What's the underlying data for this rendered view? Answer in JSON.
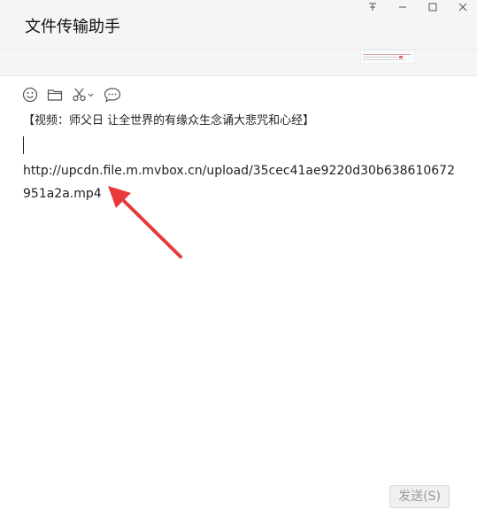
{
  "window": {
    "title": "文件传输助手",
    "controls": [
      "pin-icon",
      "minimize-icon",
      "maximize-icon",
      "close-icon"
    ]
  },
  "toolbar": {
    "icons": [
      "emoji-icon",
      "folder-icon",
      "scissors-icon",
      "chat-bubble-icon"
    ]
  },
  "editor": {
    "line1": "【视频：师父日 让全世界的有缘众生念诵大悲咒和心经】",
    "url": "http://upcdn.file.m.mvbox.cn/upload/35cec41ae9220d30b638610672951a2a.mp4"
  },
  "send_button": {
    "label": "发送(S)"
  },
  "colors": {
    "arrow": "#e83a3a",
    "title_bar_bg": "#f5f5f5",
    "send_button_bg": "#f0f0f0"
  }
}
